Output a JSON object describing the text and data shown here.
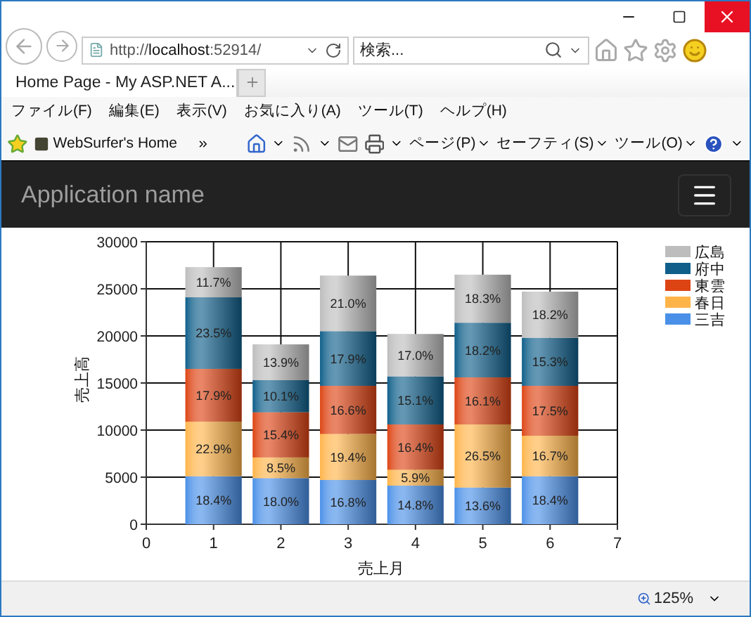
{
  "browser": {
    "address": "http://**localhost**:52914/",
    "search": {
      "placeholder": "検索..."
    },
    "tabs": [
      {
        "title": "Home Page - My ASP.NET A...",
        "selected": true
      }
    ],
    "menu": [
      "ファイル(F)",
      "編集(E)",
      "表示(V)",
      "お気に入り(A)",
      "ツール(T)",
      "ヘルプ(H)"
    ],
    "favorites": [
      "WebSurfer's Home"
    ],
    "commands": [
      "ページ(P)",
      "セーフティ(S)",
      "ツール(O)"
    ],
    "status": {
      "zoom": "125%"
    }
  },
  "page": {
    "navbar": {
      "brand": "Application name"
    },
    "chart_data": {
      "type": "bar",
      "stacked": true,
      "grid": true,
      "legend": true,
      "orientation": "vertical",
      "xlabel": "売上月",
      "ylabel": "売上高",
      "x": [
        1,
        2,
        3,
        4,
        5,
        6
      ],
      "xlim": [
        0,
        7
      ],
      "ylim": [
        0,
        30000
      ],
      "xticks": [
        0,
        1,
        2,
        3,
        4,
        5,
        6,
        7
      ],
      "yticks": [
        0,
        5000,
        10000,
        15000,
        20000,
        25000,
        30000
      ],
      "series": [
        {
          "name": "三吉",
          "color": "#4a90e8",
          "values": [
            5100,
            4900,
            4700,
            4100,
            3900,
            5100
          ]
        },
        {
          "name": "春日",
          "color": "#ffb44a",
          "values": [
            5800,
            2200,
            4900,
            1700,
            6700,
            4300
          ]
        },
        {
          "name": "東雲",
          "color": "#dd4414",
          "values": [
            5600,
            4800,
            5100,
            4800,
            5000,
            5300
          ]
        },
        {
          "name": "府中",
          "color": "#0f5f8a",
          "values": [
            7600,
            3400,
            5800,
            5100,
            5800,
            5100
          ]
        },
        {
          "name": "広島",
          "color": "#bdbdbd",
          "values": [
            3200,
            3800,
            5900,
            4500,
            5100,
            4900
          ]
        }
      ],
      "value_labels": [
        [
          "18.4%",
          "18.0%",
          "16.8%",
          "14.8%",
          "13.6%",
          "18.4%"
        ],
        [
          "22.9%",
          "8.5%",
          "19.4%",
          "5.9%",
          "26.5%",
          "16.7%"
        ],
        [
          "17.9%",
          "15.4%",
          "16.6%",
          "16.4%",
          "16.1%",
          "17.5%"
        ],
        [
          "23.5%",
          "10.1%",
          "17.9%",
          "15.1%",
          "18.2%",
          "15.3%"
        ],
        [
          "11.7%",
          "13.9%",
          "21.0%",
          "17.0%",
          "18.3%",
          "18.2%"
        ]
      ]
    }
  }
}
